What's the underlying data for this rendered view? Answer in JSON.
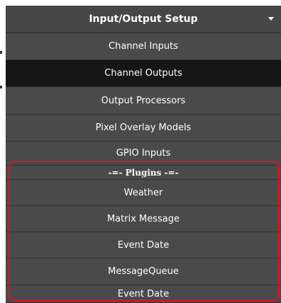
{
  "menu": {
    "title": "Input/Output Setup",
    "caret_icon": "caret-down-icon",
    "items": [
      {
        "label": "Channel Inputs",
        "active": false
      },
      {
        "label": "Channel Outputs",
        "active": true
      },
      {
        "label": "Output Processors",
        "active": false
      },
      {
        "label": "Pixel Overlay Models",
        "active": false
      },
      {
        "label": "GPIO Inputs",
        "active": false
      }
    ],
    "plugins_header": "-=- Plugins -=-",
    "plugins": [
      {
        "label": "Weather"
      },
      {
        "label": "Matrix Message"
      },
      {
        "label": "Event Date"
      },
      {
        "label": "MessageQueue"
      },
      {
        "label": "Event Date"
      }
    ]
  },
  "colors": {
    "menu_bg": "#4a4a4a",
    "active_bg": "#161616",
    "highlight": "#e0121b"
  }
}
